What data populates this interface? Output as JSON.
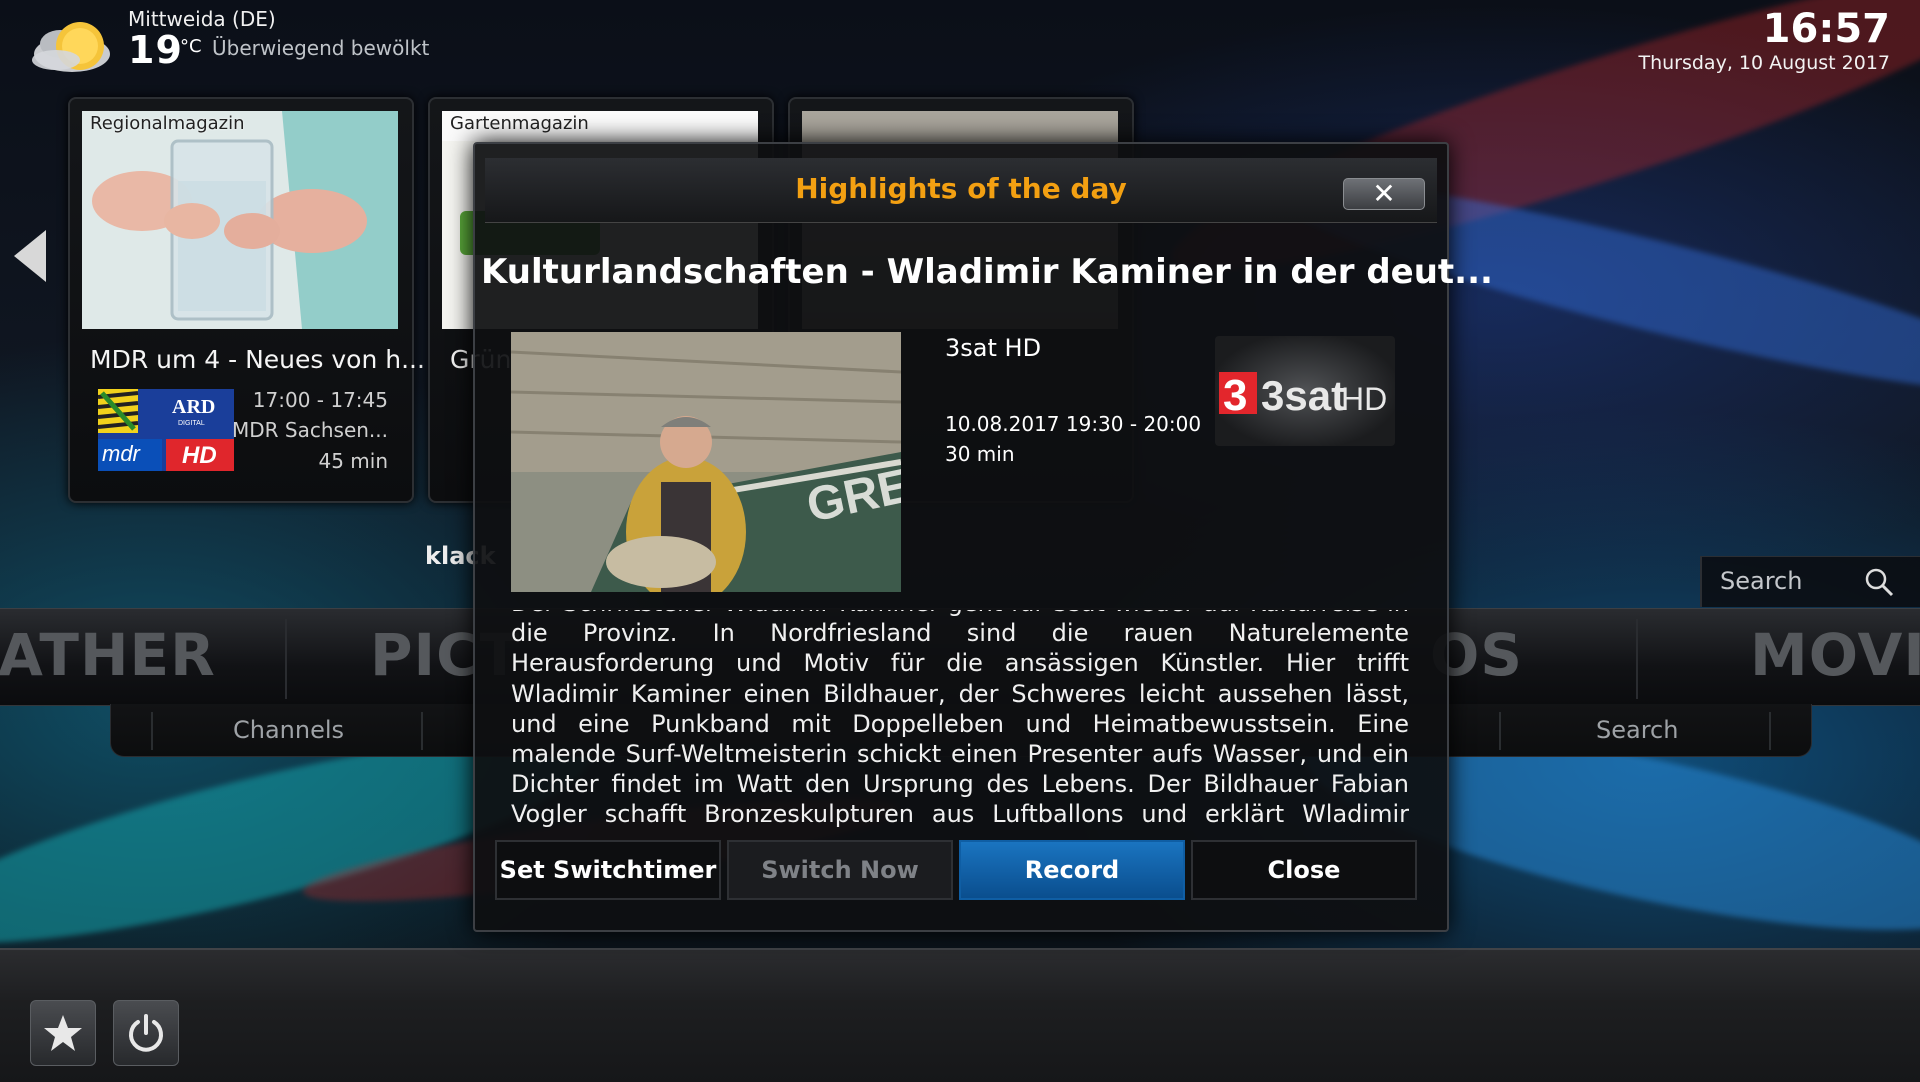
{
  "weather": {
    "location": "Mittweida (DE)",
    "temperature": "19",
    "unit": "°C",
    "condition": "Überwiegend bewölkt"
  },
  "clock": {
    "time": "16:57",
    "date": "Thursday, 10 August 2017"
  },
  "tiles": [
    {
      "genre": "Regionalmagazin",
      "title": "MDR um 4 - Neues von h...",
      "time": "17:00 - 17:45",
      "channel": "MDR Sachsen...",
      "duration": "45 min"
    },
    {
      "genre": "Gartenmagazin",
      "title": "Grün"
    }
  ],
  "partial_label": "klack",
  "main_menu": [
    "ATHER",
    "PICT",
    "OS",
    "MOVIE"
  ],
  "sub_menu": [
    "Channels",
    "Search"
  ],
  "search": {
    "label": "Search"
  },
  "dialog": {
    "heading": "Highlights of the day",
    "title": "Kulturlandschaften - Wladimir Kaminer in der deut...",
    "channel": "3sat HD",
    "datetime": "10.08.2017 19:30 - 20:00",
    "duration": "30 min",
    "logo_text": "3sat",
    "logo_hd": "HD",
    "plot": "Der Schriftsteller Wladimir Kaminer geht für 3sat wieder auf Kulturreise in die Provinz. In Nordfriesland sind die rauen Naturelemente Herausforderung und Motiv für die ansässigen Künstler. Hier trifft Wladimir Kaminer einen Bildhauer, der Schweres leicht aussehen lässt, und eine Punkband mit Doppelleben und Heimatbewusstsein. Eine malende Surf-Weltmeisterin schickt einen Presenter aufs Wasser, und ein Dichter findet im Watt den Ursprung des Lebens. Der Bildhauer Fabian Vogler schafft Bronzeskulpturen aus Luftballons und erklärt Wladimir Kaminer auf dem Weg zu den Halligen, was man vom Wattenmeer",
    "close_symbol": "✕",
    "buttons": {
      "switchtimer": "Set Switchtimer",
      "switchnow": "Switch Now",
      "record": "Record",
      "close": "Close"
    },
    "boat_text": "GRE"
  },
  "logos": {
    "ard": "ARD",
    "ard_sub": "DIGITAL",
    "mdr": "mdr",
    "hd": "HD"
  },
  "colors": {
    "accent": "#f3a012",
    "record": "#1366b0"
  }
}
